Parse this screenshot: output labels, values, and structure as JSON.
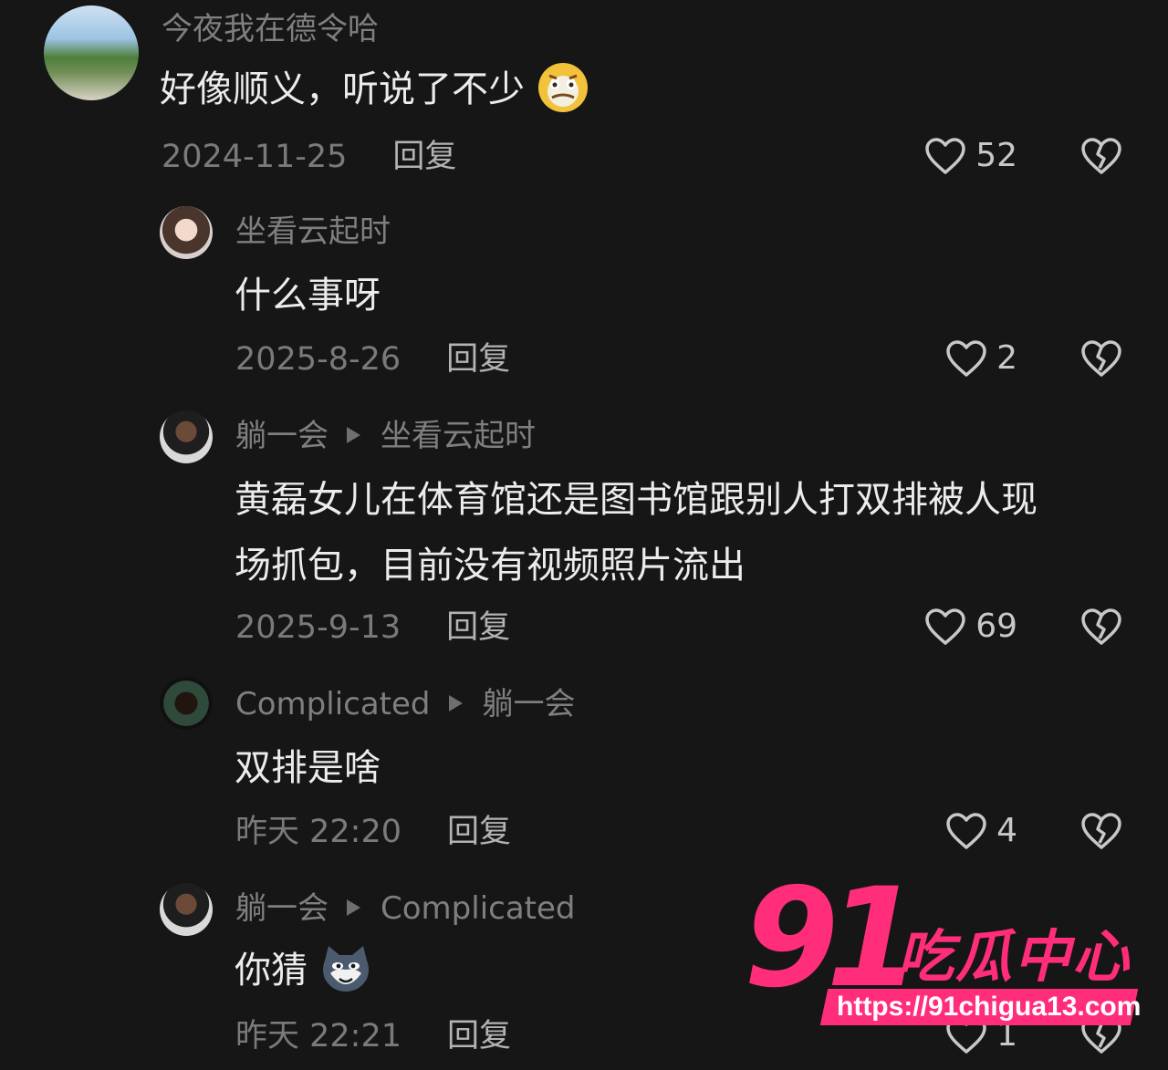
{
  "comments": [
    {
      "name": "今夜我在德令哈",
      "target": "",
      "text": "好像顺义，听说了不少",
      "emoji": "nauseated-face",
      "time": "2024-11-25",
      "reply": "回复",
      "likes": "52"
    },
    {
      "name": "坐看云起时",
      "target": "",
      "text": "什么事呀",
      "time": "2025-8-26",
      "reply": "回复",
      "likes": "2"
    },
    {
      "name": "躺一会",
      "target": "坐看云起时",
      "text_line1": "黄磊女儿在体育馆还是图书馆跟别人打双排被人现",
      "text_line2": "场抓包，目前没有视频照片流出",
      "time": "2025-9-13",
      "reply": "回复",
      "likes": "69"
    },
    {
      "name": "Complicated",
      "target": "躺一会",
      "text": "双排是啥",
      "time": "昨天 22:20",
      "reply": "回复",
      "likes": "4"
    },
    {
      "name": "躺一会",
      "target": "Complicated",
      "text": "你猜",
      "emoji": "cat-face",
      "time": "昨天 22:21",
      "reply": "回复",
      "likes": "1"
    }
  ],
  "watermark": {
    "brand_number": "91",
    "brand_text": "吃瓜中心",
    "url": "https://91chigua13.com"
  },
  "colors": {
    "background": "#161616",
    "accent": "#ff2d7a"
  }
}
